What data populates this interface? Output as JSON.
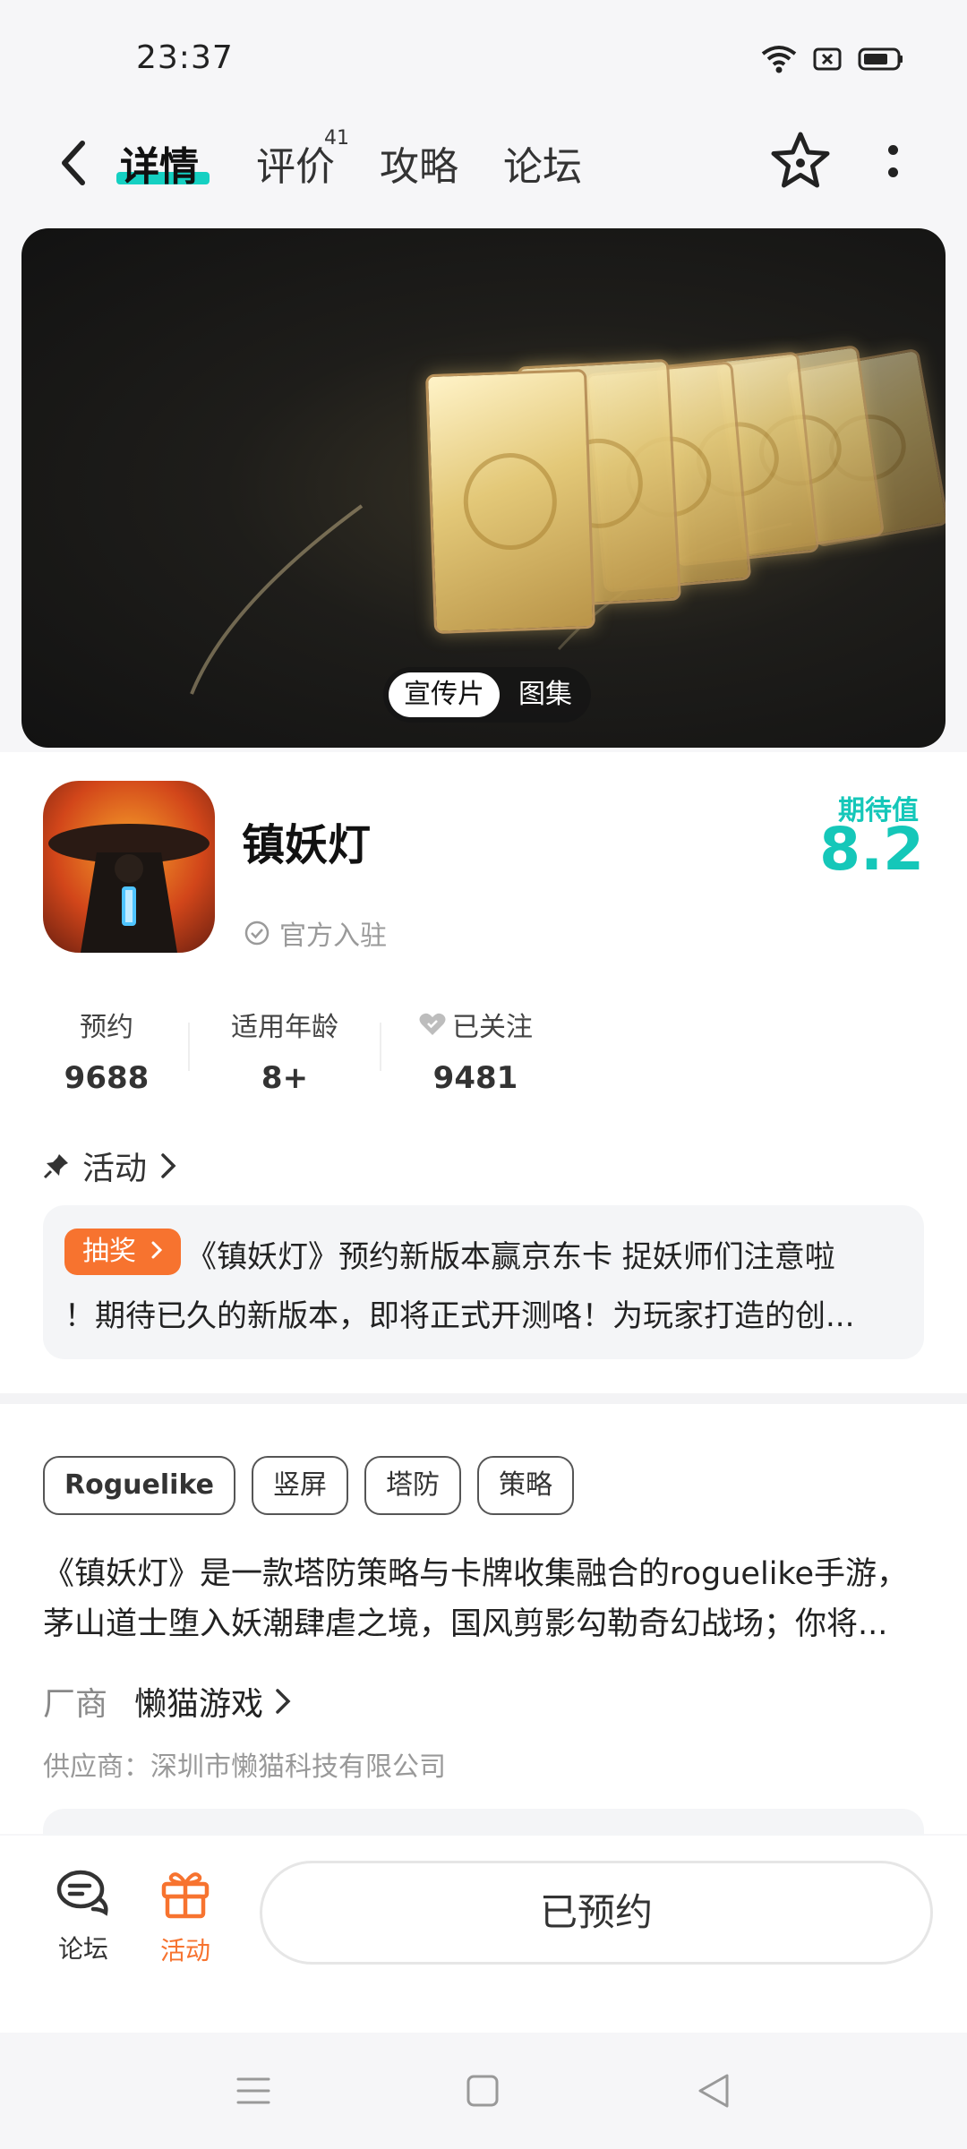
{
  "status_bar": {
    "time": "23:37"
  },
  "nav": {
    "tabs": [
      {
        "label": "详情",
        "active": true
      },
      {
        "label": "评价",
        "badge": "41"
      },
      {
        "label": "攻略"
      },
      {
        "label": "论坛"
      }
    ]
  },
  "media": {
    "tabs": [
      "宣传片",
      "图集"
    ],
    "active_tab": "宣传片"
  },
  "game": {
    "title": "镇妖灯",
    "official_label": "官方入驻",
    "expect_label": "期待值",
    "expect_value": "8.2"
  },
  "stats": [
    {
      "label": "预约",
      "value": "9688"
    },
    {
      "label": "适用年龄",
      "value": "8+"
    },
    {
      "label": "已关注",
      "value": "9481",
      "icon": "heart-icon"
    }
  ],
  "activity": {
    "heading": "活动",
    "tag": "抽奖",
    "line1": "《镇妖灯》预约新版本赢京东卡 捉妖师们注意啦",
    "line2": "！期待已久的新版本，即将正式开测咯！为玩家打造的创..."
  },
  "tags": [
    "Roguelike",
    "竖屏",
    "塔防",
    "策略"
  ],
  "description": {
    "line1": "《镇妖灯》是一款塔防策略与卡牌收集融合的roguelike手游，",
    "line2": "茅山道士堕入妖潮肆虐之境，国风剪影勾勒奇幻战场；你将..."
  },
  "vendor": {
    "label": "厂商",
    "name": "懒猫游戏"
  },
  "supplier": "供应商：深圳市懒猫科技有限公司",
  "bottom_bar": {
    "forum_label": "论坛",
    "activity_label": "活动",
    "reserve_label": "已预约"
  },
  "colors": {
    "accent": "#15c7b9",
    "orange": "#f7732f"
  }
}
